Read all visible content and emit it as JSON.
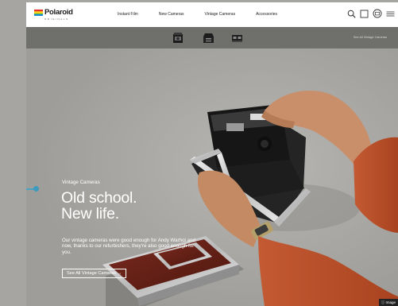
{
  "logo": {
    "word": "Polaroid",
    "sub": "ORIGINALS",
    "bar_colors": [
      "#e4312b",
      "#f6a623",
      "#f8d21c",
      "#3db549",
      "#1e8fd6"
    ]
  },
  "nav": {
    "links": [
      "Instant Film",
      "New Cameras",
      "Vintage Cameras",
      "Accessories"
    ]
  },
  "nav_icons": [
    "search-icon",
    "account-icon",
    "cart-icon",
    "menu-icon"
  ],
  "subnav": {
    "link": "See All Vintage Cameras"
  },
  "hero": {
    "eyebrow": "Vintage Cameras",
    "headline_line1": "Old school.",
    "headline_line2": "New life.",
    "body": "Our vintage cameras were good enough for Andy Warhol and now, thanks to our refurbishers, they're also good enough for you.",
    "cta": "See All Vintage Cameras →"
  },
  "badge": "ⓘ Image",
  "colors": {
    "nav_bg": "#ffffff",
    "subnav_bg": "#6f6f6c",
    "hero_bg": "#a6a5a2",
    "accent": "#3f9bbd"
  }
}
